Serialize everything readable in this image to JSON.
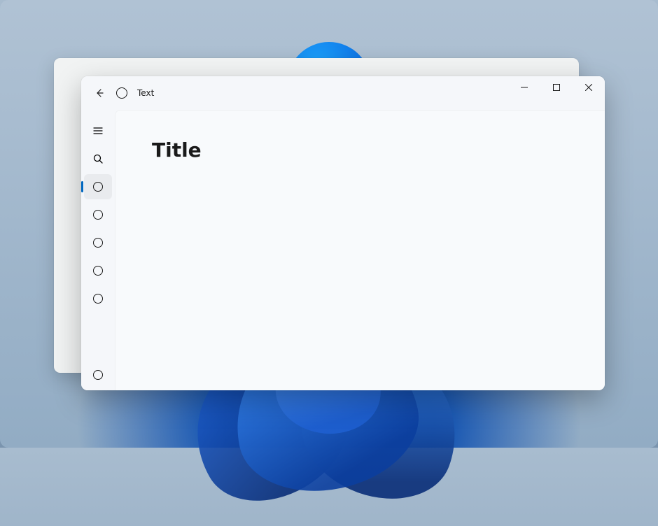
{
  "window": {
    "title": "Text",
    "page_title": "Title"
  },
  "nav": {
    "selected_index": 0,
    "item_count": 5,
    "footer_item_count": 1
  }
}
